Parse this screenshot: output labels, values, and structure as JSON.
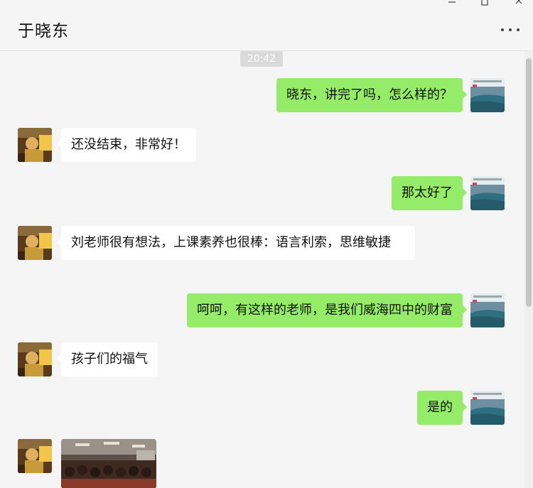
{
  "window": {
    "minimize_icon": "minimize-icon",
    "maximize_icon": "maximize-icon",
    "close_icon": "close-icon"
  },
  "header": {
    "title": "于晓东",
    "more_icon": "more-icon"
  },
  "chat": {
    "timestamp": "20:42",
    "messages": [
      {
        "direction": "out",
        "text": "晓东，讲完了吗，怎么样的？"
      },
      {
        "direction": "in",
        "text": "还没结束，非常好！"
      },
      {
        "direction": "out",
        "text": "那太好了"
      },
      {
        "direction": "in",
        "text": "刘老师很有想法，上课素养也很棒：语言利索，思维敏捷"
      },
      {
        "direction": "out",
        "text": "呵呵，有这样的老师，是我们威海四中的财富"
      },
      {
        "direction": "in",
        "text": "孩子们的福气"
      },
      {
        "direction": "out",
        "text": "是的"
      },
      {
        "direction": "in",
        "type": "image"
      }
    ]
  },
  "colors": {
    "background": "#f5f5f5",
    "outgoing_bubble": "#95ec69",
    "incoming_bubble": "#ffffff"
  }
}
